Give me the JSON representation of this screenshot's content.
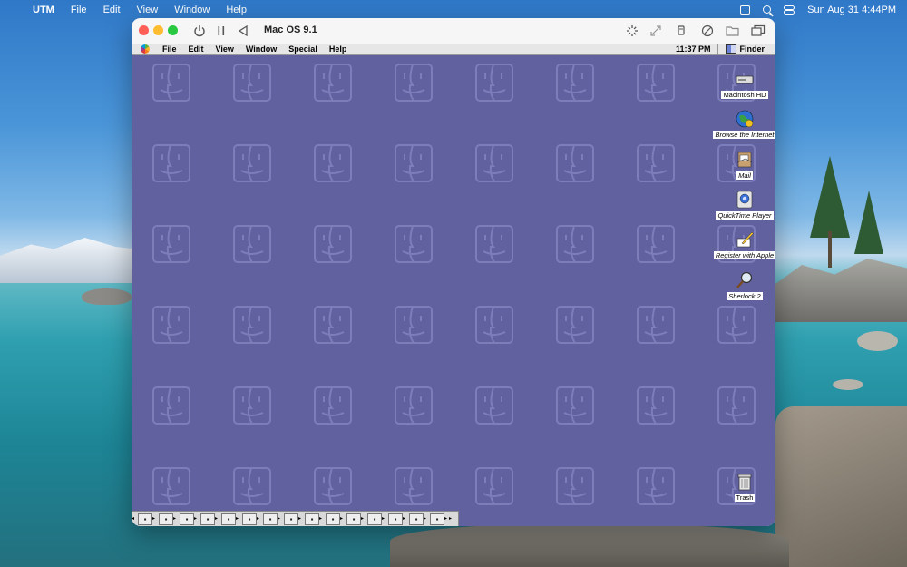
{
  "host": {
    "menubar": {
      "apple_icon": "apple-logo-icon",
      "app_name": "UTM",
      "menus": [
        "File",
        "Edit",
        "View",
        "Window",
        "Help"
      ],
      "clock": "Sun Aug 31  4:44PM"
    }
  },
  "window": {
    "title": "Mac OS 9.1",
    "toolbar_icons": [
      "power-icon",
      "pause-icon",
      "back-icon",
      "spinner-icon",
      "resize-icon",
      "usb-icon",
      "cd-icon",
      "folder-icon",
      "windows-icon"
    ]
  },
  "guest": {
    "menubar": {
      "menus": [
        "File",
        "Edit",
        "View",
        "Window",
        "Special",
        "Help"
      ],
      "clock": "11:37 PM",
      "app_menu": "Finder"
    },
    "desktop_color": "#6161a0",
    "desktop_icons": [
      {
        "label": "Macintosh HD"
      },
      {
        "label": "Browse the Internet"
      },
      {
        "label": "Mail"
      },
      {
        "label": "QuickTime Player"
      },
      {
        "label": "Register with Apple"
      },
      {
        "label": "Sherlock 2"
      },
      {
        "label": "Trash"
      }
    ]
  }
}
